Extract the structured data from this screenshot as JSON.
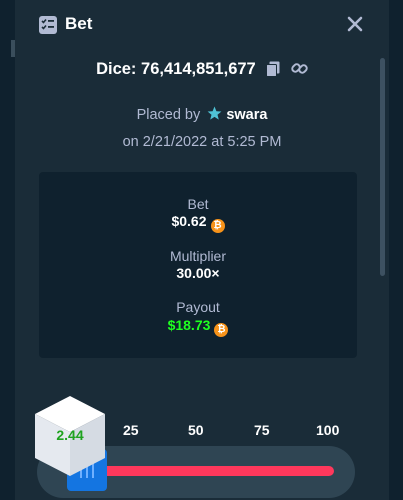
{
  "header": {
    "title": "Bet",
    "icon": "bet-list-icon",
    "close_icon": "close-icon"
  },
  "bet": {
    "game_label": "Dice:",
    "bet_id": "76,414,851,677",
    "placed_by_prefix": "Placed by",
    "username": "swara",
    "date_line": "on 2/21/2022 at 5:25 PM"
  },
  "stats": {
    "bet_label": "Bet",
    "bet_value": "$0.62",
    "multiplier_label": "Multiplier",
    "multiplier_value": "30.00×",
    "payout_label": "Payout",
    "payout_value": "$18.73",
    "currency_icon": "bitcoin-icon"
  },
  "dice_game": {
    "result": "2.44",
    "ticks": [
      "25",
      "50",
      "75",
      "100"
    ]
  },
  "colors": {
    "background": "#1a2c38",
    "panel": "#0f212e",
    "win_green": "#1fff20",
    "lose_red": "#ff385c",
    "handle_blue": "#1475e1",
    "btc_orange": "#f7931a"
  }
}
